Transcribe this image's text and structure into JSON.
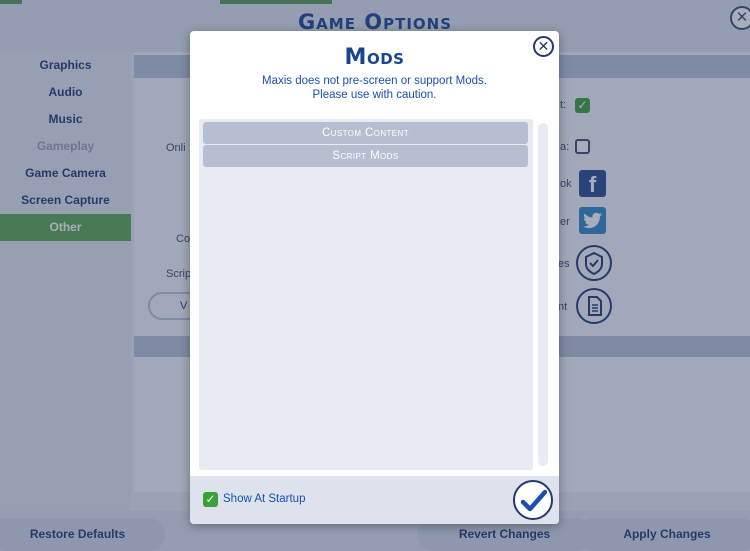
{
  "window": {
    "title": "Game Options"
  },
  "sidebar": {
    "items": [
      {
        "label": "Graphics",
        "state": "normal"
      },
      {
        "label": "Audio",
        "state": "normal"
      },
      {
        "label": "Music",
        "state": "normal"
      },
      {
        "label": "Gameplay",
        "state": "disabled"
      },
      {
        "label": "Game Camera",
        "state": "normal"
      },
      {
        "label": "Screen Capture",
        "state": "normal"
      },
      {
        "label": "Other",
        "state": "active"
      }
    ]
  },
  "background_fragments": {
    "onli": "Onli",
    "co": "Co",
    "scrip": "Scrip",
    "v": "V",
    "t_colon": "t:",
    "a_colon": "a:",
    "ok": "ok",
    "er": "er",
    "es": "es",
    "nt": "nt"
  },
  "social": {
    "facebook_glyph": "f",
    "twitter_glyph": "🐦"
  },
  "footer": {
    "restore_defaults": "Restore Defaults",
    "revert_changes": "Revert Changes",
    "apply_changes": "Apply Changes"
  },
  "modal": {
    "title": "Mods",
    "subtitle_line1": "Maxis does not pre-screen or support Mods.",
    "subtitle_line2": "Please use with caution.",
    "close_glyph": "✕",
    "items": [
      {
        "label": "Custom Content"
      },
      {
        "label": "Script Mods"
      }
    ],
    "show_at_startup_label": "Show At Startup",
    "show_at_startup_checked": true,
    "check_glyph": "✓"
  },
  "colors": {
    "accent_blue": "#17458f",
    "active_green": "#5aaa4e",
    "checkbox_green": "#3aa03a",
    "facebook": "#27498f",
    "twitter": "#2b87c8"
  },
  "icons": [
    "close-icon",
    "checkmark-icon",
    "facebook-icon",
    "twitter-icon",
    "shield-check-icon",
    "document-icon"
  ]
}
